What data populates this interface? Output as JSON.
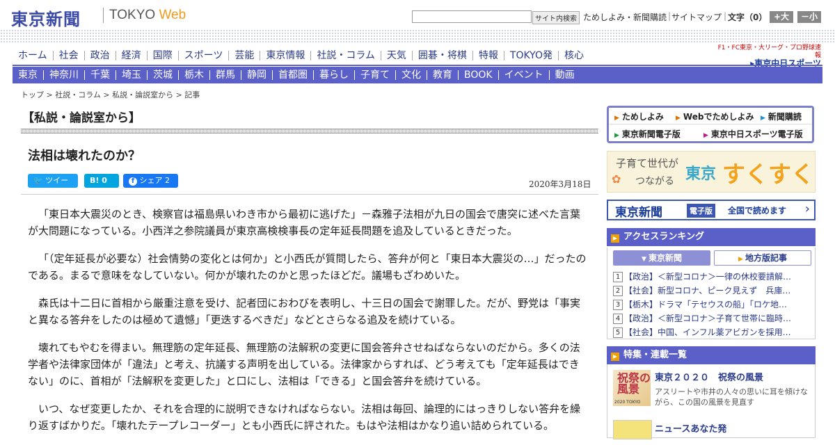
{
  "header": {
    "logo_jp": "東京新聞",
    "logo_en_prefix": "TOKYO",
    "logo_en_suffix": " Web",
    "search_button": "サイト内検索",
    "search_value": "",
    "links": [
      "ためしよみ・新聞購読",
      "サイトマップ"
    ],
    "font_size_label": "文字（0）",
    "size_up": "+大",
    "size_down": "－小"
  },
  "nav_primary": [
    "ホーム",
    "社会",
    "政治",
    "経済",
    "国際",
    "スポーツ",
    "芸能",
    "東京情報",
    "社説・コラム",
    "天気",
    "囲碁・将棋",
    "特報",
    "TOKYO発",
    "核心"
  ],
  "chunichi_banner": {
    "line1": "F1・FC東京・大リーグ・プロ野球速報",
    "line2": "▸東京中日スポーツ"
  },
  "nav_regional": [
    "東京",
    "神奈川",
    "千葉",
    "埼玉",
    "茨城",
    "栃木",
    "群馬",
    "静岡",
    "首都圏",
    "暮らし",
    "子育て",
    "文化",
    "教育",
    "BOOK",
    "イベント",
    "動画"
  ],
  "breadcrumb": "トップ > 社説・コラム > 私説・論説室から > 記事",
  "section_title": "【私説・論説室から】",
  "article": {
    "title": "法相は壊れたのか？",
    "date": "2020年3月18日",
    "share": {
      "tweet": "ツイート",
      "hatena": "B! 0",
      "facebook": "シェア 2"
    },
    "paragraphs": [
      "「東日本大震災のとき、検察官は福島県いわき市から最初に逃げた」－森雅子法相が九日の国会で唐突に述べた言葉が大問題になっている。小西洋之参院議員が東京高検検事長の定年延長問題を追及しているときだった。",
      "「（定年延長が必要な）社会情勢の変化とは何か」と小西氏が質問したら、答弁が何と「東日本大震災の…」だったのである。まるで意味をなしていない。何かが壊れたのかと思ったほどだ。議場もざわめいた。",
      "森氏は十二日に首相から厳重注意を受け、記者団におわびを表明し、十三日の国会で謝罪した。だが、野党は「事実と異なる答弁をしたのは極めて遺憾」「更迭するべきだ」などとさらなる追及を続けている。",
      "壊れてもやむを得まい。無理筋の定年延長、無理筋の法解釈の変更に国会答弁させねばならないのだから。多くの法学者や法律家団体が「違法」と考え、抗議する声明を出している。法律家からすれば、どう考えても「定年延長はできない」のに、首相が「法解釈を変更した」と口にし、法相は「できる」と国会答弁を続けている。",
      "いつ、なぜ変更したか、それを合理的に説明できなければならない。法相は毎回、論理的にはっきりしない答弁を繰り返すばかりだ。「壊れたテープレコーダー」とも小西氏に評された。もはや法相はかなり追い詰められている。"
    ]
  },
  "sidebar": {
    "quick_links": [
      "ためしよみ",
      "Webでためしよみ",
      "新聞購読",
      "東京新聞電子版",
      "東京中日スポーツ電子版"
    ],
    "sukusuku": {
      "line1": "子育て世代が",
      "line2": "つながる",
      "brand1": "東京",
      "brand2": "すくすく"
    },
    "denshi": {
      "name": "東京新聞",
      "tag": "電子版",
      "text": "全国で読めます"
    },
    "ranking": {
      "title": "アクセスランキング",
      "tabs": [
        "東京新聞",
        "地方版記事"
      ],
      "items": [
        {
          "num": "1",
          "text": "【政治】＜新型コロナ＞一律の休校要請解…"
        },
        {
          "num": "2",
          "text": "【社会】新型コロナ、ピーク見えず　兵庫…"
        },
        {
          "num": "3",
          "text": "【栃木】ドラマ「テセウスの船」「ロケ地…"
        },
        {
          "num": "4",
          "text": "【政治】＜新型コロナ＞子育て世帯に臨時…"
        },
        {
          "num": "5",
          "text": "【社会】中国、インフル薬アビガンを採用…"
        }
      ]
    },
    "features": {
      "title": "特集・連載一覧",
      "item1_title": "東京２０２０　祝祭の風景",
      "item1_desc": "アスリートや市井の人々の思いに耳を傾けながら、この国の風景を見直す",
      "item1_thumb": "祝祭の風景",
      "item1_thumb_caption": "2020 TOKYO",
      "item2_title": "ニュースあなた発"
    }
  },
  "colors": {
    "brand_blue": "#3a4aa6",
    "nav_purple": "#5b5fc8",
    "web_orange": "#f19a1d"
  }
}
